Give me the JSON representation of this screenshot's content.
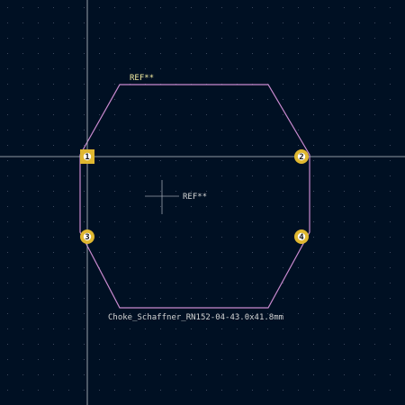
{
  "colors": {
    "background": "#001023",
    "grid_dot": "#3d4a5f",
    "crosshair": "#c0c4cc",
    "courtyard": "#c98ad0",
    "silkscreen_ref": "#f2eba0",
    "fab_text": "#d4d4d4",
    "center_cross": "#9aa2ae",
    "pad_ring": "#e0b830",
    "pad_drill": "#ffffff",
    "pad_number": "#1a1a1a"
  },
  "footprint": {
    "ref_silkscreen": "REF**",
    "ref_fab": "REF**",
    "value": "Choke_Schaffner_RN152-04-43.0x41.8mm"
  },
  "pads": [
    {
      "number": "1",
      "shape": "square"
    },
    {
      "number": "2",
      "shape": "circle"
    },
    {
      "number": "3",
      "shape": "circle"
    },
    {
      "number": "4",
      "shape": "circle"
    }
  ]
}
